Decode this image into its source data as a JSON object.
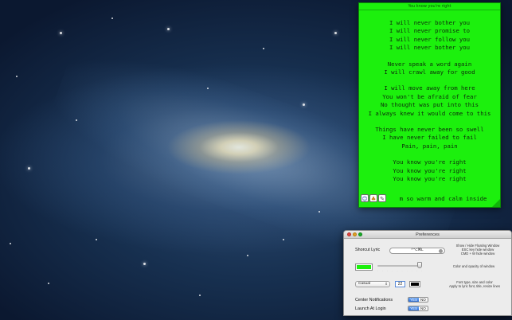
{
  "lyric_window": {
    "title": "You know you're right",
    "background_color": "#1cf00d",
    "lines": [
      "I will never bother you",
      "I will never promise to",
      "I will never follow you",
      "I will never bother you",
      "",
      "Never speak a word again",
      "I will crawl away for good",
      "",
      "I will move away from here",
      "You won't be afraid of fear",
      "No thought was put into this",
      "I always knew it would come to this",
      "",
      "Things have never been so swell",
      "I have never failed to fail",
      "Pain, pain, pain",
      "",
      "You know you're right",
      "You know you're right",
      "You know you're right"
    ],
    "last_line": "m so warm and calm inside",
    "bottom_icons": [
      "finder-icon",
      "app-icon",
      "quill-icon"
    ]
  },
  "preferences": {
    "title": "Preferences",
    "shortcut_label": "Shorcut Lyric",
    "shortcut_value": "^⌥⌘L",
    "shortcut_hint": [
      "Show / Hide Floating Window",
      "ESC key hide window",
      "CMD + W hide window"
    ],
    "color_hint": "Color and opacity of window",
    "window_color": "#1cf00d",
    "opacity_level": 0.95,
    "font_name": "Casual",
    "font_size": "22",
    "text_color": "#000000",
    "font_hint": [
      "Font type, size and color",
      "Apply to lyric font, title, resize lines"
    ],
    "center_notifications_label": "Center Notifications",
    "launch_at_login_label": "Launch At Login",
    "yes_label": "YES",
    "no_label": "NO",
    "center_notifications_value": "YES",
    "launch_at_login_value": "YES"
  }
}
